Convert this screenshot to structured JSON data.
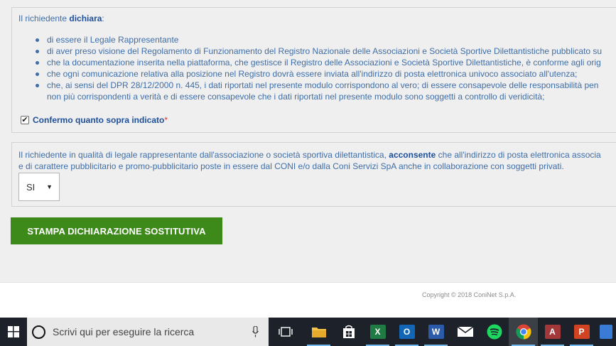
{
  "declaration": {
    "lead_prefix": "Il richiedente",
    "lead_keyword": "dichiara",
    "lead_suffix": ":",
    "items": [
      "di essere il Legale Rappresentante",
      "di aver preso visione del Regolamento di Funzionamento del Registro Nazionale delle Associazioni e Società Sportive Dilettantistiche pubblicato su",
      "che la documentazione inserita nella piattaforma, che gestisce il Registro delle Associazioni e Società Sportive Dilettantistiche, è conforme agli orig",
      "che ogni comunicazione relativa alla posizione nel Registro dovrà essere inviata all'indirizzo di posta elettronica univoco associato all'utenza;",
      "che, ai sensi del DPR 28/12/2000 n. 445, i dati riportati nel presente modulo corrispondono al vero; di essere consapevole delle responsabilità pen",
      "non più corrispondenti a verità e di essere consapevole che i dati riportati nel presente modulo sono soggetti a controllo di veridicità;"
    ],
    "confirm_checked": "✔",
    "confirm_label": "Confermo quanto sopra indicato",
    "required_mark": "*"
  },
  "consent": {
    "line1_prefix": "Il richiedente in qualità di legale rappresentante dall'associazione o società sportiva dilettantistica,",
    "line1_keyword": "acconsente",
    "line1_suffix": "che all'indirizzo di posta elettronica associa",
    "line2": "e di carattere pubblicitario e promo-pubblicitario poste in essere dal CONI e/o dalla Coni Servizi SpA anche in collaborazione con soggetti privati.",
    "select_value": "SI",
    "select_caret": "▼"
  },
  "print_button": {
    "label": "STAMPA DICHIARAZIONE SOSTITUTIVA"
  },
  "footer": {
    "copyright": "Copyright © 2018 ConiNet S.p.A."
  },
  "taskbar": {
    "search_placeholder": "Scrivi qui per eseguire la ricerca",
    "apps": [
      {
        "icon": "task-view-icon"
      },
      {
        "icon": "file-explorer-icon"
      },
      {
        "icon": "store-icon"
      },
      {
        "icon": "excel-icon",
        "letter": "X"
      },
      {
        "icon": "outlook-icon",
        "letter": "O"
      },
      {
        "icon": "word-icon",
        "letter": "W"
      },
      {
        "icon": "mail-icon"
      },
      {
        "icon": "spotify-icon"
      },
      {
        "icon": "chrome-icon"
      },
      {
        "icon": "access-icon",
        "letter": "A"
      },
      {
        "icon": "powerpoint-icon",
        "letter": "P"
      },
      {
        "icon": "app-icon"
      }
    ]
  },
  "colors": {
    "link_blue": "#1d4f9a",
    "text_blue": "#3f6ea8",
    "button_green": "#3d8a1a",
    "required_red": "#e0342c",
    "taskbar_bg": "#1d2129"
  }
}
